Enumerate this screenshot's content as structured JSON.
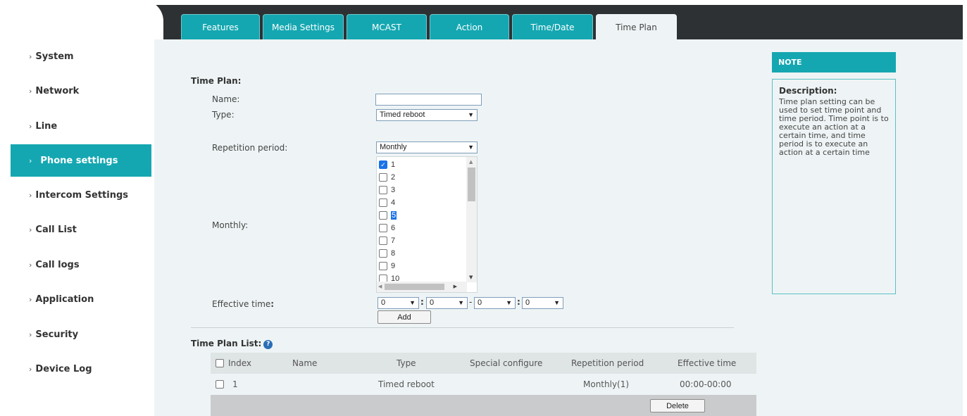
{
  "tabs": [
    {
      "label": "Features"
    },
    {
      "label": "Media Settings"
    },
    {
      "label": "MCAST"
    },
    {
      "label": "Action"
    },
    {
      "label": "Time/Date"
    },
    {
      "label": "Time Plan"
    }
  ],
  "active_tab": "Time Plan",
  "sidebar": {
    "items": [
      {
        "label": "System"
      },
      {
        "label": "Network"
      },
      {
        "label": "Line"
      },
      {
        "label": "Phone settings"
      },
      {
        "label": "Intercom Settings"
      },
      {
        "label": "Call List"
      },
      {
        "label": "Call logs"
      },
      {
        "label": "Application"
      },
      {
        "label": "Security"
      },
      {
        "label": "Device Log"
      }
    ],
    "active": "Phone settings"
  },
  "form": {
    "section_title": "Time Plan:",
    "name_label": "Name:",
    "name_value": "",
    "type_label": "Type:",
    "type_value": "Timed reboot",
    "repetition_label": "Repetition period:",
    "repetition_value": "Monthly",
    "monthly_label": "Monthly:",
    "days": [
      {
        "label": "1",
        "checked": true
      },
      {
        "label": "2",
        "checked": false
      },
      {
        "label": "3",
        "checked": false
      },
      {
        "label": "4",
        "checked": false
      },
      {
        "label": "5",
        "checked": false
      },
      {
        "label": "6",
        "checked": false
      },
      {
        "label": "7",
        "checked": false
      },
      {
        "label": "8",
        "checked": false
      },
      {
        "label": "9",
        "checked": false
      },
      {
        "label": "10",
        "checked": false
      }
    ],
    "effective_label_prefix": "Effective time",
    "effective_label_suffix": ":",
    "effective_values": [
      "0",
      "0",
      "0",
      "0"
    ],
    "time_sep_colon": ":",
    "time_sep_dash": "-",
    "add_label": "Add"
  },
  "list": {
    "title": "Time Plan List:",
    "help_icon": "question-circle-icon",
    "columns": [
      "Index",
      "Name",
      "Type",
      "Special configure",
      "Repetition period",
      "Effective time"
    ],
    "rows": [
      {
        "index": "1",
        "name": "",
        "type": "Timed reboot",
        "special": "",
        "repetition": "Monthly(1)",
        "effective": "00:00-00:00"
      }
    ],
    "delete_label": "Delete"
  },
  "note": {
    "header": "NOTE",
    "title": "Description:",
    "text": "Time plan setting can be used to set time point and time period. Time point is to execute an action at a certain time, and time period is to execute an action at a certain time"
  },
  "colors": {
    "accent": "#14a7b1",
    "topbar": "#2e3133",
    "panel": "#eef4f5"
  }
}
